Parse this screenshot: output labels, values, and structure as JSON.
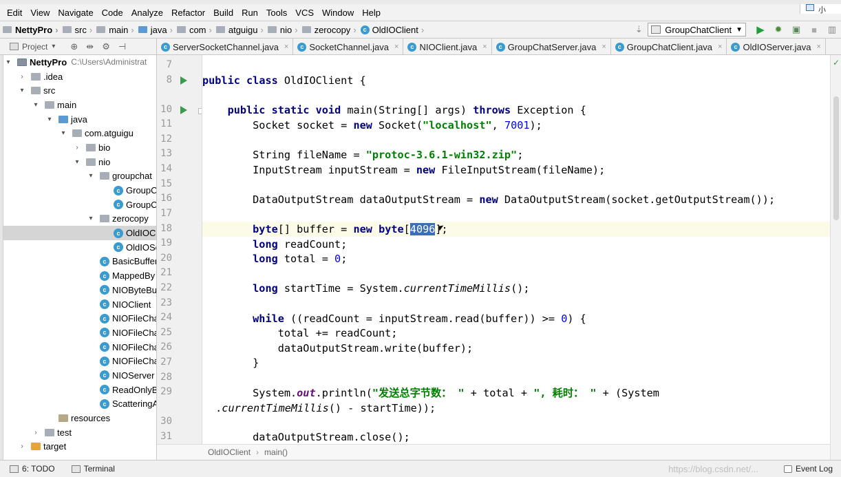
{
  "menu": [
    "Edit",
    "View",
    "Navigate",
    "Code",
    "Analyze",
    "Refactor",
    "Build",
    "Run",
    "Tools",
    "VCS",
    "Window",
    "Help"
  ],
  "notification": {
    "label": "小"
  },
  "nav": {
    "crumbs": [
      {
        "label": "NettyPro",
        "icon": "module-icon",
        "bold": true
      },
      {
        "label": "src",
        "icon": "folder-icon"
      },
      {
        "label": "main",
        "icon": "folder-icon"
      },
      {
        "label": "java",
        "icon": "source-folder-icon"
      },
      {
        "label": "com",
        "icon": "package-icon"
      },
      {
        "label": "atguigu",
        "icon": "package-icon"
      },
      {
        "label": "nio",
        "icon": "package-icon"
      },
      {
        "label": "zerocopy",
        "icon": "package-icon"
      },
      {
        "label": "OldIOClient",
        "icon": "class-icon"
      }
    ],
    "run_config": "GroupChatClient"
  },
  "project_panel": {
    "title": "Project"
  },
  "tabs": [
    {
      "label": "ServerSocketChannel.java",
      "active": false
    },
    {
      "label": "SocketChannel.java",
      "active": false
    },
    {
      "label": "NIOClient.java",
      "active": false
    },
    {
      "label": "GroupChatServer.java",
      "active": false
    },
    {
      "label": "GroupChatClient.java",
      "active": false
    },
    {
      "label": "OldIOServer.java",
      "active": false
    }
  ],
  "tree": {
    "root_label": "NettyPro",
    "root_path": "C:\\Users\\Administrat",
    "idea": ".idea",
    "src": "src",
    "main": "main",
    "java": "java",
    "com_atguigu": "com.atguigu",
    "bio": "bio",
    "nio": "nio",
    "groupchat": "groupchat",
    "groupchat_children": [
      "GroupC",
      "GroupC"
    ],
    "zerocopy": "zerocopy",
    "zerocopy_children": [
      "OldIOCl",
      "OldIOSe"
    ],
    "nio_classes": [
      "BasicBuffer",
      "MappedBy",
      "NIOByteBu",
      "NIOClient",
      "NIOFileCha",
      "NIOFileCha",
      "NIOFileCha",
      "NIOFileCha",
      "NIOServer",
      "ReadOnlyB",
      "ScatteringA"
    ],
    "resources": "resources",
    "test": "test",
    "target": "target"
  },
  "editor": {
    "line_numbers": [
      "7",
      "8",
      "10",
      "11",
      "12",
      "13",
      "14",
      "15",
      "16",
      "17",
      "18",
      "19",
      "20",
      "21",
      "22",
      "23",
      "24",
      "25",
      "26",
      "27",
      "28",
      "29",
      "30",
      "31"
    ],
    "code": {
      "l8a": "public",
      "l8b": " ",
      "l8c": "class",
      "l8d": " OldIOClient {",
      "l10a": "    ",
      "l10b": "public",
      "l10c": " ",
      "l10d": "static",
      "l10e": " ",
      "l10f": "void",
      "l10g": " main(String[] args) ",
      "l10h": "throws",
      "l10i": " Exception {",
      "l11a": "        Socket socket = ",
      "l11b": "new",
      "l11c": " Socket(",
      "l11d": "\"localhost\"",
      "l11e": ", ",
      "l11f": "7001",
      "l11g": ");",
      "l13a": "        String fileName = ",
      "l13b": "\"protoc-3.6.1-win32.zip\"",
      "l13c": ";",
      "l14a": "        InputStream inputStream = ",
      "l14b": "new",
      "l14c": " FileInputStream(fileName);",
      "l16a": "        DataOutputStream dataOutputStream = ",
      "l16b": "new",
      "l16c": " DataOutputStream(socket.getOutputStream());",
      "l18a": "        ",
      "l18b": "byte",
      "l18c": "[] buffer = ",
      "l18d": "new",
      "l18e": " ",
      "l18f": "byte",
      "l18g": "[",
      "l18h": "4096",
      "l18i": "];",
      "l19a": "        ",
      "l19b": "long",
      "l19c": " readCount;",
      "l20a": "        ",
      "l20b": "long",
      "l20c": " total = ",
      "l20d": "0",
      "l20e": ";",
      "l22a": "        ",
      "l22b": "long",
      "l22c": " startTime = System.",
      "l22d": "currentTimeMillis",
      "l22e": "();",
      "l24a": "        ",
      "l24b": "while",
      "l24c": " ((readCount = inputStream.read(buffer)) >= ",
      "l24d": "0",
      "l24e": ") {",
      "l25a": "            total += readCount;",
      "l26a": "            dataOutputStream.write(buffer);",
      "l27a": "        }",
      "l29a": "        System.",
      "l29b": "out",
      "l29c": ".println(",
      "l29d": "\"发送总字节数： \"",
      "l29e": " + total + ",
      "l29f": "\", 耗时： \"",
      "l29g": " + (System",
      "l29w1": " .",
      "l29w2": "currentTimeMillis",
      "l29w3": "() - startTime));",
      "l31a": "        dataOutputStream.close();"
    }
  },
  "breadcrumb": {
    "class": "OldIOClient",
    "method": "main()"
  },
  "statusbar": {
    "todo": "6: TODO",
    "terminal": "Terminal",
    "watermark": "https://blog.csdn.net/...",
    "eventlog": "Event Log"
  }
}
